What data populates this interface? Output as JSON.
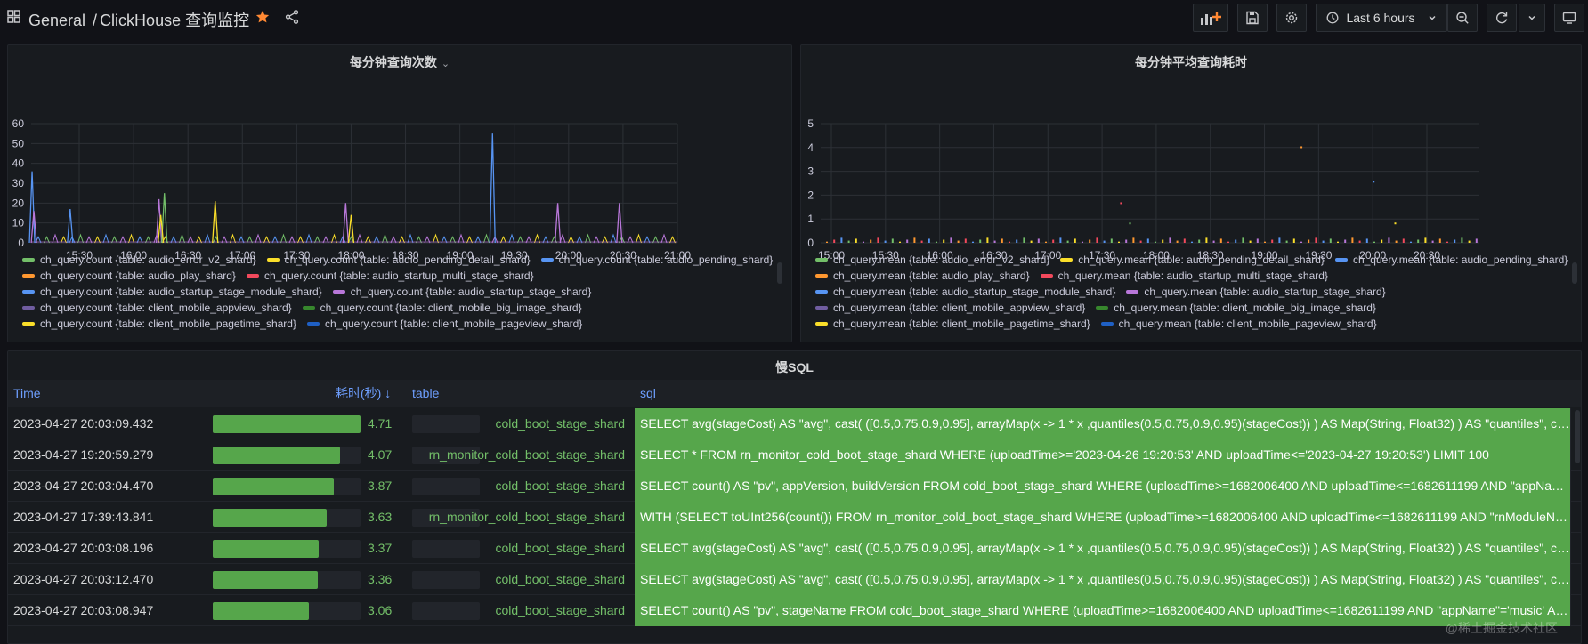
{
  "header": {
    "folder": "General",
    "separator": "/",
    "dashboard_title": "ClickHouse 查询监控",
    "time_range": "Last 6 hours",
    "colors": {
      "star": "#ff8833",
      "accent": "#6e9fff"
    }
  },
  "icons": [
    "grid-icon",
    "star-icon",
    "share-icon",
    "add-panel-icon",
    "save-icon",
    "gear-icon",
    "clock-icon",
    "chevron-down-icon",
    "zoom-out-icon",
    "refresh-icon",
    "tv-icon"
  ],
  "query_count_panel": {
    "title": "每分钟查询次数",
    "chart_data": {
      "type": "line",
      "title": "每分钟查询次数",
      "ylim": [
        0,
        60
      ],
      "yticks": [
        "60",
        "50",
        "40",
        "30",
        "20",
        "10",
        "0"
      ],
      "xticks": [
        "15:30",
        "16:00",
        "16:30",
        "17:00",
        "17:30",
        "18:00",
        "18:30",
        "19:00",
        "19:30",
        "20:00",
        "20:30",
        "21:00"
      ],
      "grid": true,
      "legend_position": "bottom",
      "spikes": [
        {
          "time": "15:04",
          "value": 36,
          "series": "ch_query.count {table: audio_pending_shard}"
        },
        {
          "time": "15:05",
          "value": 16,
          "series": "ch_query.count {table: audio_startup_stage_shard}"
        },
        {
          "time": "15:25",
          "value": 17,
          "series": "ch_query.count {table: audio_pending_shard}"
        },
        {
          "time": "16:14",
          "value": 22,
          "series": "ch_query.count {table: audio_startup_stage_shard}"
        },
        {
          "time": "16:17",
          "value": 25,
          "series": "ch_query.count {table: audio_error_v2_shard}"
        },
        {
          "time": "16:15",
          "value": 14,
          "series": "ch_query.count {table: audio_pending_detail_shard}"
        },
        {
          "time": "16:45",
          "value": 21,
          "series": "ch_query.count {table: audio_pending_detail_shard}"
        },
        {
          "time": "17:57",
          "value": 20,
          "series": "ch_query.count {table: audio_startup_stage_shard}"
        },
        {
          "time": "18:00",
          "value": 14,
          "series": "ch_query.count {table: audio_pending_detail_shard}"
        },
        {
          "time": "19:18",
          "value": 55,
          "series": "ch_query.count {table: audio_pending_shard}"
        },
        {
          "time": "19:54",
          "value": 20,
          "series": "ch_query.count {table: audio_startup_stage_shard}"
        },
        {
          "time": "20:28",
          "value": 20,
          "series": "ch_query.count {table: audio_startup_stage_shard}"
        }
      ],
      "series": [
        {
          "name": "ch_query.count {table: audio_error_v2_shard}",
          "color": "#73bf69"
        },
        {
          "name": "ch_query.count {table: audio_pending_detail_shard}",
          "color": "#fade2a"
        },
        {
          "name": "ch_query.count {table: audio_pending_shard}",
          "color": "#5794f2"
        },
        {
          "name": "ch_query.count {table: audio_play_shard}",
          "color": "#ff9830"
        },
        {
          "name": "ch_query.count {table: audio_startup_multi_stage_shard}",
          "color": "#f2495c"
        },
        {
          "name": "ch_query.count {table: audio_startup_stage_module_shard}",
          "color": "#5794f2"
        },
        {
          "name": "ch_query.count {table: audio_startup_stage_shard}",
          "color": "#b877d9"
        },
        {
          "name": "ch_query.count {table: client_mobile_appview_shard}",
          "color": "#705da0"
        },
        {
          "name": "ch_query.count {table: client_mobile_big_image_shard}",
          "color": "#37872d"
        },
        {
          "name": "ch_query.count {table: client_mobile_pagetime_shard}",
          "color": "#fade2a"
        },
        {
          "name": "ch_query.count {table: client_mobile_pageview_shard}",
          "color": "#1f60c4"
        }
      ]
    }
  },
  "query_mean_panel": {
    "title": "每分钟平均查询耗时",
    "chart_data": {
      "type": "scatter",
      "title": "每分钟平均查询耗时",
      "ylim": [
        0,
        5
      ],
      "yticks": [
        "5",
        "4",
        "3",
        "2",
        "1",
        "0"
      ],
      "xticks": [
        "15:00",
        "15:30",
        "16:00",
        "16:30",
        "17:00",
        "17:30",
        "18:00",
        "18:30",
        "19:00",
        "19:30",
        "20:00",
        "20:30"
      ],
      "grid": true,
      "legend_position": "bottom",
      "notable_points": [
        {
          "time": "19:20",
          "value": 4.05
        },
        {
          "time": "17:40",
          "value": 1.7
        },
        {
          "time": "20:00",
          "value": 2.6
        },
        {
          "time": "17:45",
          "value": 0.85
        },
        {
          "time": "20:12",
          "value": 0.85
        }
      ],
      "series": [
        {
          "name": "ch_query.mean {table: audio_error_v2_shard}",
          "color": "#73bf69"
        },
        {
          "name": "ch_query.mean {table: audio_pending_detail_shard}",
          "color": "#fade2a"
        },
        {
          "name": "ch_query.mean {table: audio_pending_shard}",
          "color": "#5794f2"
        },
        {
          "name": "ch_query.mean {table: audio_play_shard}",
          "color": "#ff9830"
        },
        {
          "name": "ch_query.mean {table: audio_startup_multi_stage_shard}",
          "color": "#f2495c"
        },
        {
          "name": "ch_query.mean {table: audio_startup_stage_module_shard}",
          "color": "#5794f2"
        },
        {
          "name": "ch_query.mean {table: audio_startup_stage_shard}",
          "color": "#b877d9"
        },
        {
          "name": "ch_query.mean {table: client_mobile_appview_shard}",
          "color": "#705da0"
        },
        {
          "name": "ch_query.mean {table: client_mobile_big_image_shard}",
          "color": "#37872d"
        },
        {
          "name": "ch_query.mean {table: client_mobile_pagetime_shard}",
          "color": "#fade2a"
        },
        {
          "name": "ch_query.mean {table: client_mobile_pageview_shard}",
          "color": "#1f60c4"
        }
      ]
    }
  },
  "slow_sql_panel": {
    "title": "慢SQL",
    "columns": {
      "time": "Time",
      "duration": "耗时(秒)",
      "sort_indicator": "↓",
      "table": "table",
      "sql": "sql"
    },
    "max_duration": 4.71,
    "rows": [
      {
        "time": "2023-04-27 20:03:09.432",
        "duration": "4.71",
        "fraction": 1.0,
        "table": "cold_boot_stage_shard",
        "sql": "SELECT avg(stageCost) AS \"avg\", cast( ([0.5,0.75,0.9,0.95], arrayMap(x -> 1 * x ,quantiles(0.5,0.75,0.9,0.95)(stageCost)) ) AS Map(String, Float32) ) AS \"quantiles\", co..."
      },
      {
        "time": "2023-04-27 19:20:59.279",
        "duration": "4.07",
        "fraction": 0.864,
        "table": "rn_monitor_cold_boot_stage_shard",
        "sql": "SELECT * FROM rn_monitor_cold_boot_stage_shard WHERE (uploadTime>='2023-04-26 19:20:53' AND uploadTime<='2023-04-27 19:20:53') LIMIT 100"
      },
      {
        "time": "2023-04-27 20:03:04.470",
        "duration": "3.87",
        "fraction": 0.822,
        "table": "cold_boot_stage_shard",
        "sql": "SELECT count() AS \"pv\", appVersion, buildVersion FROM cold_boot_stage_shard WHERE (uploadTime>=1682006400 AND uploadTime<=1682611199 AND \"appNam..."
      },
      {
        "time": "2023-04-27 17:39:43.841",
        "duration": "3.63",
        "fraction": 0.771,
        "table": "rn_monitor_cold_boot_stage_shard",
        "sql": "WITH (SELECT toUInt256(count()) FROM rn_monitor_cold_boot_stage_shard WHERE (uploadTime>=1682006400 AND uploadTime<=1682611199 AND \"rnModuleNa..."
      },
      {
        "time": "2023-04-27 20:03:08.196",
        "duration": "3.37",
        "fraction": 0.716,
        "table": "cold_boot_stage_shard",
        "sql": "SELECT avg(stageCost) AS \"avg\", cast( ([0.5,0.75,0.9,0.95], arrayMap(x -> 1 * x ,quantiles(0.5,0.75,0.9,0.95)(stageCost)) ) AS Map(String, Float32) ) AS \"quantiles\", co..."
      },
      {
        "time": "2023-04-27 20:03:12.470",
        "duration": "3.36",
        "fraction": 0.713,
        "table": "cold_boot_stage_shard",
        "sql": "SELECT avg(stageCost) AS \"avg\", cast( ([0.5,0.75,0.9,0.95], arrayMap(x -> 1 * x ,quantiles(0.5,0.75,0.9,0.95)(stageCost)) ) AS Map(String, Float32) ) AS \"quantiles\", co..."
      },
      {
        "time": "2023-04-27 20:03:08.947",
        "duration": "3.06",
        "fraction": 0.65,
        "table": "cold_boot_stage_shard",
        "sql": "SELECT count() AS \"pv\", stageName FROM cold_boot_stage_shard WHERE (uploadTime>=1682006400 AND uploadTime<=1682611199 AND \"appName\"='music' AN..."
      }
    ]
  },
  "watermark": "@稀土掘金技术社区"
}
